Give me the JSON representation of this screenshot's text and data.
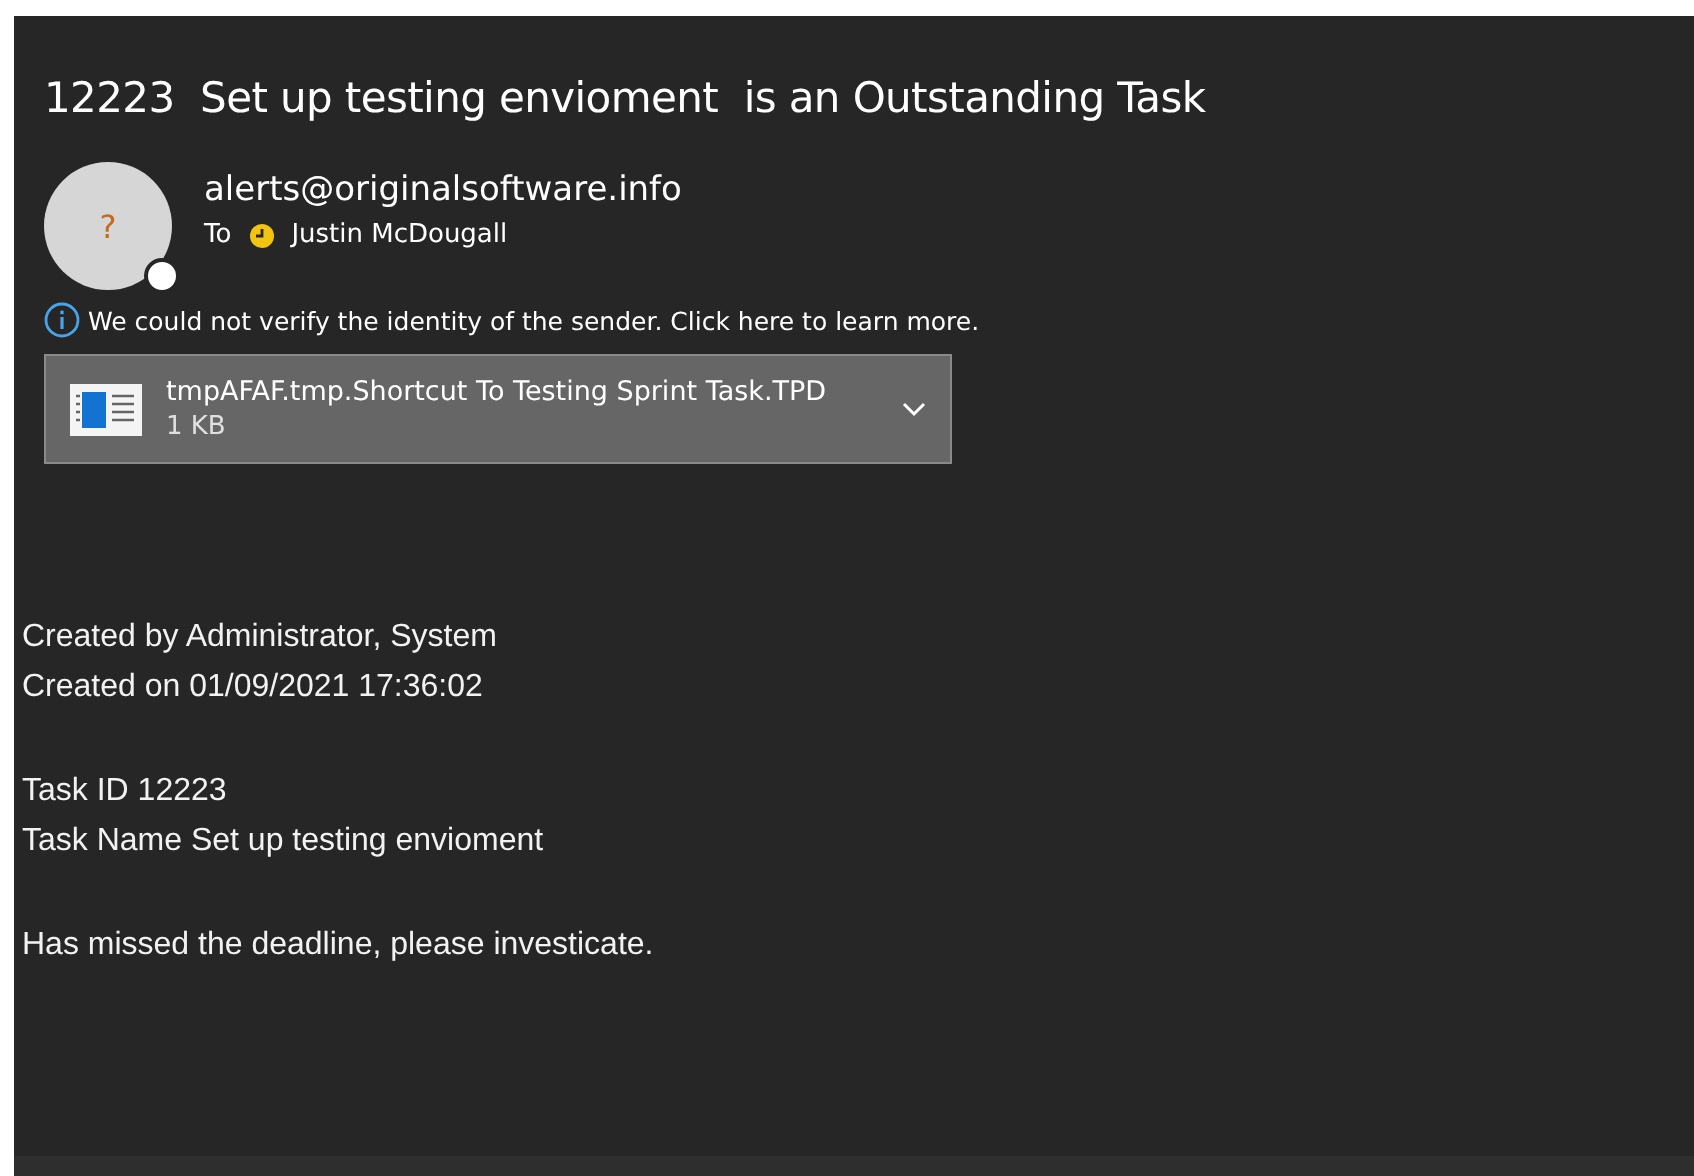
{
  "subject": "12223  Set up testing envioment  is an Outstanding Task",
  "sender": {
    "avatar_text": "?",
    "address": "alerts@originalsoftware.info",
    "to_label": "To",
    "recipient": "Justin McDougall"
  },
  "warning": "We could not verify the identity of the sender. Click here to learn more.",
  "attachment": {
    "name": "tmpAFAF.tmp.Shortcut To Testing Sprint Task.TPD",
    "size": "1 KB"
  },
  "body": [
    [
      "Created by Administrator, System",
      "Created on 01/09/2021 17:36:02"
    ],
    [
      "Task ID 12223",
      "Task Name Set up testing envioment"
    ],
    [
      "Has missed the deadline, please investicate."
    ]
  ]
}
